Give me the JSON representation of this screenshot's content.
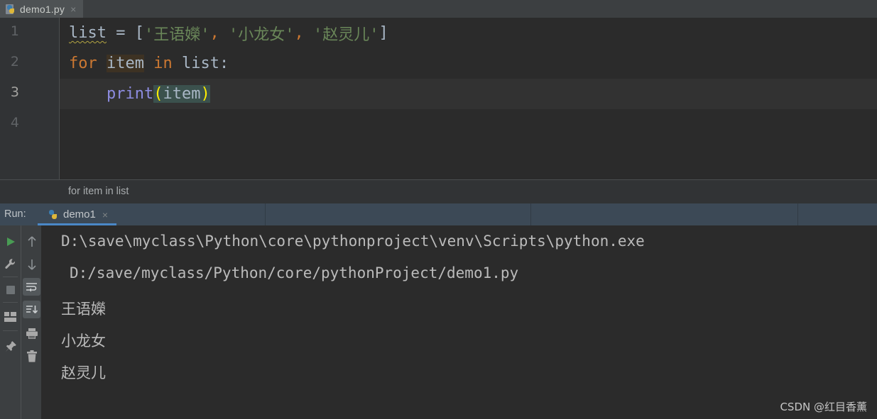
{
  "colors": {
    "editor_bg": "#2b2b2b",
    "gutter_bg": "#313335",
    "tabbar_bg": "#3c3f41",
    "active_tab_bg": "#4e5254",
    "run_header_bg": "#3c4956",
    "run_tab_accent": "#4a88c7",
    "toolbar_bg": "#3c3f41",
    "keyword": "#cc7832",
    "string": "#6a8759",
    "function": "#8d8ce0",
    "default_text": "#a9b7c6",
    "console_text": "#bbbbbb",
    "line_highlight": "#323232",
    "identifier_highlight": "#3d3223",
    "brace_match_highlight": "#3b514d",
    "brace_paren": "#ffef00",
    "squiggly_warning": "#b5a642",
    "run_play": "#499c54"
  },
  "editor_tabs": [
    {
      "label": "demo1.py",
      "icon": "python-file-icon",
      "close": "×",
      "active": true
    }
  ],
  "editor": {
    "line_numbers": [
      "1",
      "2",
      "3",
      "4"
    ],
    "current_line": 3,
    "lines": [
      {
        "number": "1",
        "tokens": [
          {
            "text": "list",
            "style": "var-squiggle"
          },
          {
            "text": " = ",
            "style": "plain"
          },
          {
            "text": "[",
            "style": "bracket"
          },
          {
            "text": "'王语嬫'",
            "style": "string"
          },
          {
            "text": ",",
            "style": "comma"
          },
          {
            "text": " ",
            "style": "plain"
          },
          {
            "text": "'小龙女'",
            "style": "string"
          },
          {
            "text": ",",
            "style": "comma"
          },
          {
            "text": " ",
            "style": "plain"
          },
          {
            "text": "'赵灵儿'",
            "style": "string"
          },
          {
            "text": "]",
            "style": "bracket"
          }
        ]
      },
      {
        "number": "2",
        "tokens": [
          {
            "text": "for",
            "style": "keyword"
          },
          {
            "text": " ",
            "style": "plain"
          },
          {
            "text": "item",
            "style": "identifier-highlight"
          },
          {
            "text": " ",
            "style": "plain"
          },
          {
            "text": "in",
            "style": "keyword"
          },
          {
            "text": " ",
            "style": "plain"
          },
          {
            "text": "list",
            "style": "plain"
          },
          {
            "text": ":",
            "style": "plain"
          }
        ]
      },
      {
        "number": "3",
        "tokens": [
          {
            "text": "    ",
            "style": "plain"
          },
          {
            "text": "print",
            "style": "function"
          },
          {
            "text": "(",
            "style": "paren-highlight"
          },
          {
            "text": "item",
            "style": "brace-inner"
          },
          {
            "text": ")",
            "style": "paren-highlight"
          }
        ]
      },
      {
        "number": "4",
        "tokens": []
      }
    ],
    "full_text": "list = ['王语嬫', '小龙女', '赵灵儿']\nfor item in list:\n    print(item)"
  },
  "breadcrumb": {
    "text": "for item in list"
  },
  "run_panel": {
    "label": "Run:",
    "tab": {
      "label": "demo1",
      "icon": "python-run-icon",
      "close": "×",
      "active": true
    },
    "left_toolbar": [
      {
        "name": "rerun-button",
        "icon": "play-icon",
        "tooltip": "Rerun"
      },
      {
        "name": "settings-button",
        "icon": "wrench-icon",
        "tooltip": "Settings"
      },
      {
        "name": "stop-button",
        "icon": "stop-square-icon",
        "tooltip": "Stop"
      },
      {
        "name": "layout-button",
        "icon": "layout-icon",
        "tooltip": "Layout"
      },
      {
        "name": "pin-button",
        "icon": "pin-icon",
        "tooltip": "Pin Tab"
      }
    ],
    "right_toolbar": [
      {
        "name": "up-button",
        "icon": "arrow-up-icon",
        "tooltip": "Up the Stack Trace"
      },
      {
        "name": "down-button",
        "icon": "arrow-down-icon",
        "tooltip": "Down the Stack Trace"
      },
      {
        "name": "soft-wrap-button",
        "icon": "soft-wrap-icon",
        "tooltip": "Soft-Wrap",
        "active": true
      },
      {
        "name": "scroll-to-end-button",
        "icon": "scroll-to-end-icon",
        "tooltip": "Scroll to End",
        "active": true
      },
      {
        "name": "print-button",
        "icon": "printer-icon",
        "tooltip": "Print"
      },
      {
        "name": "clear-button",
        "icon": "trash-icon",
        "tooltip": "Clear All"
      }
    ]
  },
  "console": {
    "lines": [
      {
        "text": "D:\\save\\myclass\\Python\\core\\pythonproject\\venv\\Scripts\\python.exe",
        "type": "path"
      },
      {
        "text": "D:/save/myclass/Python/core/pythonProject/demo1.py",
        "type": "path",
        "indented": true
      },
      {
        "text": "王语嬫",
        "type": "output"
      },
      {
        "text": "小龙女",
        "type": "output"
      },
      {
        "text": "赵灵儿",
        "type": "output"
      }
    ]
  },
  "watermark": {
    "text": "CSDN @红目香薰"
  }
}
